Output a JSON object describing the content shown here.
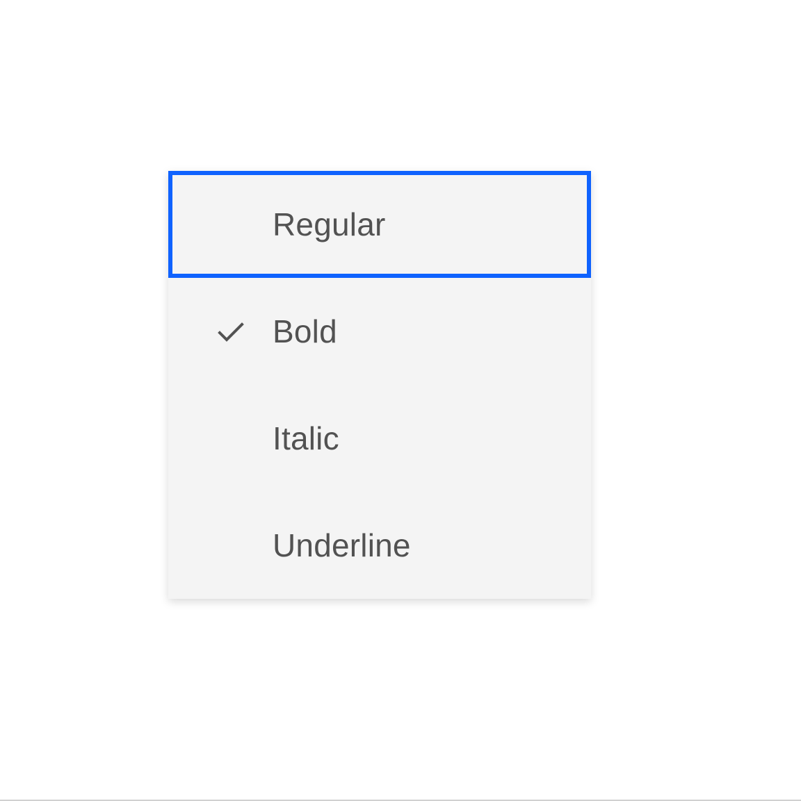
{
  "menu": {
    "items": [
      {
        "label": "Regular",
        "checked": false,
        "focused": true
      },
      {
        "label": "Bold",
        "checked": true,
        "focused": false
      },
      {
        "label": "Italic",
        "checked": false,
        "focused": false
      },
      {
        "label": "Underline",
        "checked": false,
        "focused": false
      }
    ]
  },
  "colors": {
    "focus": "#0f62fe",
    "menu_bg": "#f4f4f4",
    "text": "#525252"
  }
}
